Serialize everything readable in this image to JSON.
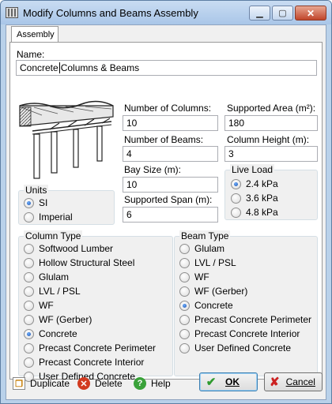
{
  "window": {
    "title": "Modify  Columns and Beams Assembly"
  },
  "titlebar_buttons": {
    "minimize": "▁",
    "maximize": "▢",
    "close": "✕"
  },
  "tab": {
    "label": "Assembly"
  },
  "name": {
    "label": "Name:",
    "value_before_caret": "Concrete",
    "value_after_caret": "Columns & Beams"
  },
  "fields": {
    "num_columns": {
      "label": "Number of Columns:",
      "value": "10"
    },
    "supported_area": {
      "label": "Supported Area (m²):",
      "value": "180"
    },
    "num_beams": {
      "label": "Number of Beams:",
      "value": "4"
    },
    "column_height": {
      "label": "Column Height (m):",
      "value": "3"
    },
    "bay_size": {
      "label": "Bay Size (m):",
      "value": "10"
    },
    "supported_span": {
      "label": "Supported Span (m):",
      "value": "6"
    }
  },
  "units": {
    "title": "Units",
    "options": [
      "SI",
      "Imperial"
    ],
    "selected": "SI"
  },
  "live_load": {
    "title": "Live Load",
    "options": [
      "2.4 kPa",
      "3.6 kPa",
      "4.8 kPa"
    ],
    "selected": "2.4 kPa"
  },
  "column_type": {
    "title": "Column Type",
    "options": [
      "Softwood Lumber",
      "Hollow Structural Steel",
      "Glulam",
      "LVL / PSL",
      "WF",
      "WF (Gerber)",
      "Concrete",
      "Precast Concrete Perimeter",
      "Precast Concrete Interior",
      "User Defined Concrete"
    ],
    "selected": "Concrete"
  },
  "beam_type": {
    "title": "Beam Type",
    "options": [
      "Glulam",
      "LVL / PSL",
      "WF",
      "WF (Gerber)",
      "Concrete",
      "Precast Concrete Perimeter",
      "Precast Concrete Interior",
      "User Defined Concrete"
    ],
    "selected": "Concrete"
  },
  "footer": {
    "duplicate": "Duplicate",
    "delete": "Delete",
    "help": "Help",
    "ok": "OK",
    "cancel": "Cancel"
  },
  "icons": {
    "app": "app-icon",
    "duplicate": "duplicate-icon",
    "delete": "delete-icon",
    "help": "help-icon",
    "ok": "checkmark-icon",
    "cancel": "cancel-x-icon"
  },
  "colors": {
    "title_bg": "#b9d1ea",
    "close_button": "#c0452a",
    "ok_check": "#2e9a2e",
    "cancel_x": "#cc2222",
    "radio_selected": "#1c4fa8"
  }
}
